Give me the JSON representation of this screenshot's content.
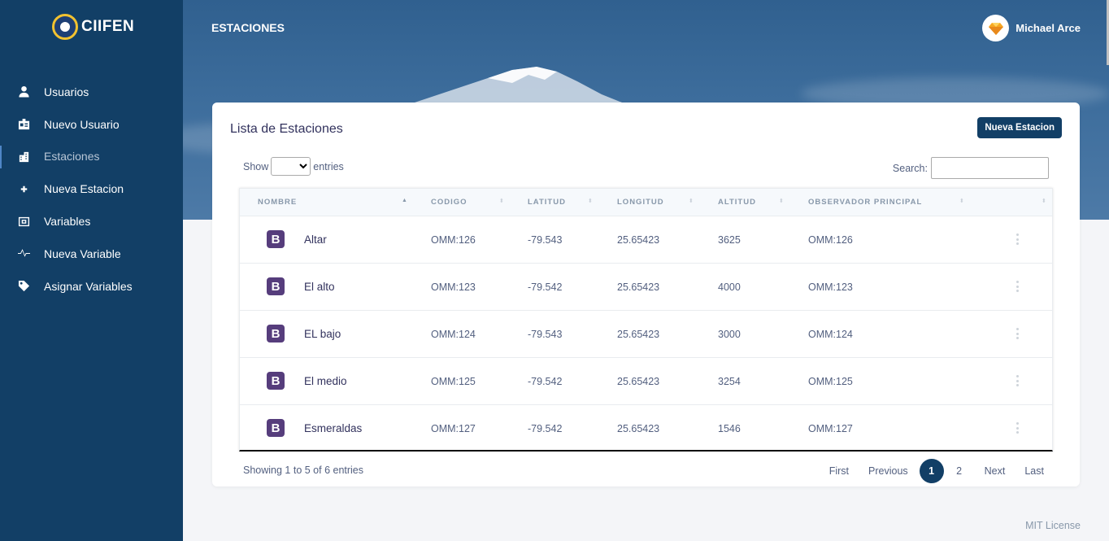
{
  "brand": {
    "name": "CIIFEN"
  },
  "sidebar": {
    "items": [
      {
        "label": "Usuarios",
        "icon": "user-icon"
      },
      {
        "label": "Nuevo Usuario",
        "icon": "id-card-icon"
      },
      {
        "label": "Estaciones",
        "icon": "building-icon",
        "active": true
      },
      {
        "label": "Nueva Estacion",
        "icon": "plus-icon"
      },
      {
        "label": "Variables",
        "icon": "memory-icon"
      },
      {
        "label": "Nueva Variable",
        "icon": "heartbeat-icon"
      },
      {
        "label": "Asignar Variables",
        "icon": "tag-icon"
      }
    ]
  },
  "header": {
    "title": "ESTACIONES",
    "user_name": "Michael Arce"
  },
  "card": {
    "title": "Lista de Estaciones",
    "new_button": "Nueva Estacion",
    "show_label": "Show",
    "entries_label": "entries",
    "search_label": "Search:",
    "search_value": ""
  },
  "table": {
    "columns": [
      "NOMBRE",
      "CODIGO",
      "LATITUD",
      "LONGITUD",
      "ALTITUD",
      "OBSERVADOR PRINCIPAL"
    ],
    "rows": [
      {
        "icon": "B",
        "nombre": "Altar",
        "codigo": "OMM:126",
        "latitud": "-79.543",
        "longitud": "25.65423",
        "altitud": "3625",
        "observador": "OMM:126"
      },
      {
        "icon": "B",
        "nombre": "El alto",
        "codigo": "OMM:123",
        "latitud": "-79.542",
        "longitud": "25.65423",
        "altitud": "4000",
        "observador": "OMM:123"
      },
      {
        "icon": "B",
        "nombre": "EL bajo",
        "codigo": "OMM:124",
        "latitud": "-79.543",
        "longitud": "25.65423",
        "altitud": "3000",
        "observador": "OMM:124"
      },
      {
        "icon": "B",
        "nombre": "El medio",
        "codigo": "OMM:125",
        "latitud": "-79.542",
        "longitud": "25.65423",
        "altitud": "3254",
        "observador": "OMM:125"
      },
      {
        "icon": "B",
        "nombre": "Esmeraldas",
        "codigo": "OMM:127",
        "latitud": "-79.542",
        "longitud": "25.65423",
        "altitud": "1546",
        "observador": "OMM:127"
      }
    ]
  },
  "pagination": {
    "info": "Showing 1 to 5 of 6 entries",
    "first": "First",
    "previous": "Previous",
    "pages": [
      "1",
      "2"
    ],
    "current": "1",
    "next": "Next",
    "last": "Last"
  },
  "footer": {
    "license": "MIT License"
  },
  "colors": {
    "sidebar": "#123f66",
    "accent": "#123f66",
    "bootstrap_icon": "#563d7c"
  }
}
